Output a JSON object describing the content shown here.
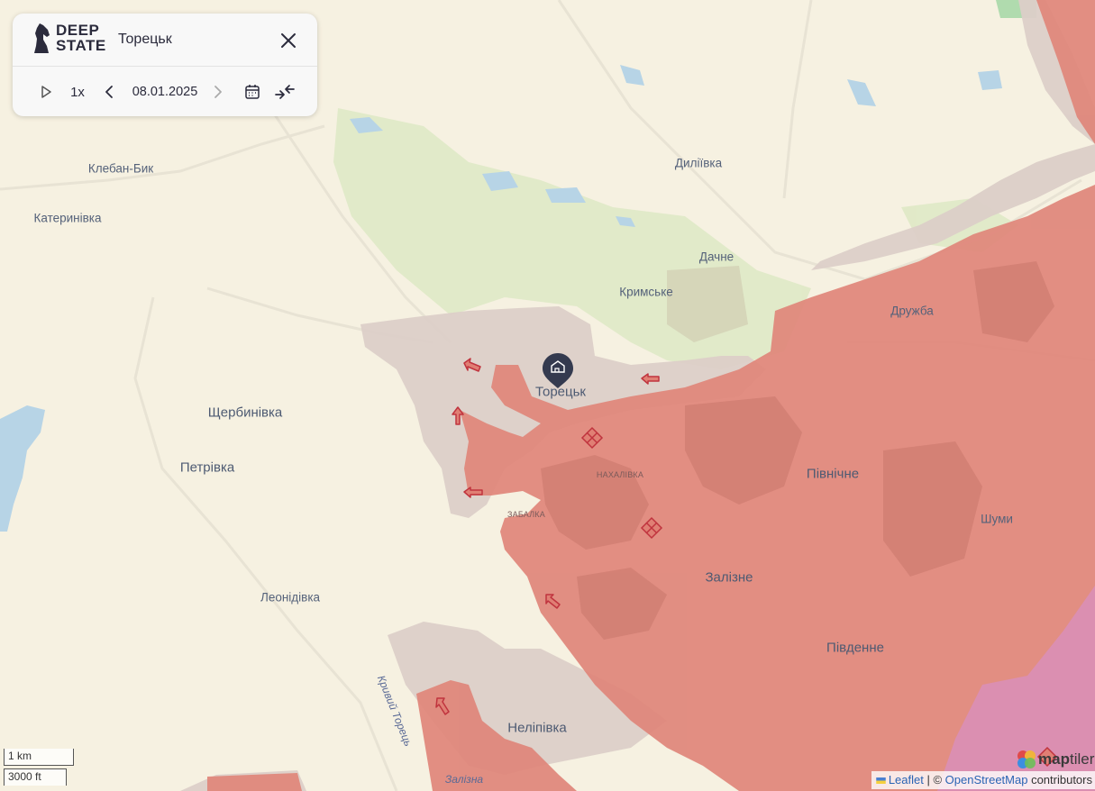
{
  "panel": {
    "logo_line1": "DEEP",
    "logo_line2": "STATE",
    "title": "Торецьк",
    "speed": "1x",
    "date": "08.01.2025",
    "icons": [
      "close-icon",
      "play-icon",
      "chevron-left-icon",
      "chevron-right-icon",
      "calendar-icon",
      "collapse-arrows-icon"
    ]
  },
  "places": {
    "kleban_byk": "Клебан-Бик",
    "katerynivka": "Катеринівка",
    "diliivka": "Диліївка",
    "dachne": "Дачне",
    "krymske": "Кримське",
    "druzhba": "Дружба",
    "toretsk": "Торецьк",
    "shcherbynivka": "Щербинівка",
    "petrivka": "Петрівка",
    "nakhalivka": "НАХАЛІВКА",
    "zabalka": "ЗАБАЛКА",
    "pivnichne": "Північне",
    "shumy": "Шуми",
    "zalizne": "Залізне",
    "leonidivka": "Леонідівка",
    "pivdenne": "Південне",
    "nelipivka": "Неліпівка",
    "kryvyi_torets": "Кривий Торець",
    "zalizna": "Залізна"
  },
  "scale": {
    "metric": "1 km",
    "imperial": "3000 ft"
  },
  "attribution": {
    "leaflet": "Leaflet",
    "separator": " | © ",
    "osm": "OpenStreetMap",
    "contributors": " contributors",
    "maptiler_a": "map",
    "maptiler_b": "tiler"
  },
  "colors": {
    "background": "#f6f1e1",
    "occupied": "#e07f74",
    "contested": "#ddcfc8",
    "forest": "#dce8c3",
    "water": "#b7d4e6",
    "liberated_pink": "#d98fba",
    "arrow": "#c0343e"
  }
}
